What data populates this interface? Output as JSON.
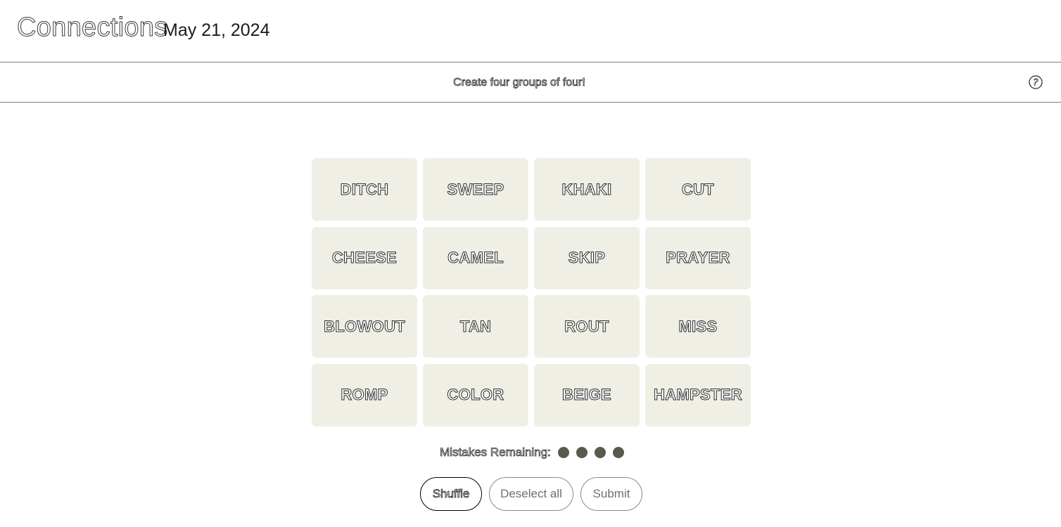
{
  "header": {
    "title": "Connections",
    "date": "May 21, 2024"
  },
  "subbar": {
    "instructions": "Create four groups of four!",
    "help_icon": "help-circle-icon"
  },
  "board": {
    "tiles": [
      "DITCH",
      "SWEEP",
      "KHAKI",
      "CUT",
      "CHEESE",
      "CAMEL",
      "SKIP",
      "PRAYER",
      "BLOWOUT",
      "TAN",
      "ROUT",
      "MISS",
      "ROMP",
      "COLOR",
      "BEIGE",
      "HAMPSTER"
    ]
  },
  "mistakes": {
    "label": "Mistakes Remaining:",
    "remaining": 4,
    "dot_color": "#5a594e"
  },
  "actions": {
    "shuffle_label": "Shuffle",
    "deselect_label": "Deselect all",
    "submit_label": "Submit"
  },
  "colors": {
    "tile_background": "#efefe6",
    "divider": "#7f7f7f"
  }
}
